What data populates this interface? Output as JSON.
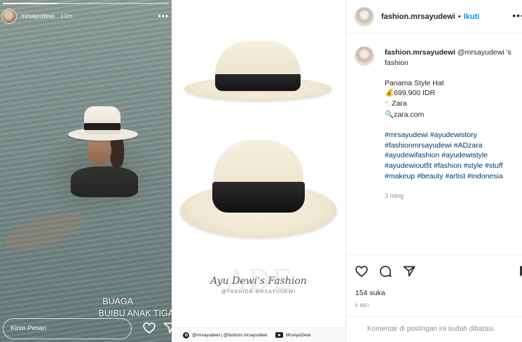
{
  "story": {
    "username": "mrsayudewi",
    "time": "13m",
    "progress": 0.33,
    "caption_line1": "BUAGA",
    "caption_line2": "BUIBU ANAK TIGA",
    "reply_placeholder": "Kirim Pesan"
  },
  "product_image": {
    "watermark": "ADE",
    "brand_name": "Ayu Dewi's Fashion",
    "brand_handle": "@FASHION.MRSAYUDEWI",
    "footer_instagram": "@mrsayudewi | @fashion.mrsayudewi",
    "footer_youtube": "MrsAyuDewi"
  },
  "post": {
    "header": {
      "username": "fashion.mrsayudewi",
      "separator": "•",
      "follow_label": "Ikuti"
    },
    "caption": {
      "username": "fashion.mrsayudewi",
      "mention": "@mrsayudewi 's",
      "line1_cont": "fashion",
      "product": "Panama Style Hat",
      "price_icon": "💰",
      "price": "699.900 IDR",
      "brand_icon": "🏷",
      "brand": "Zara",
      "site_icon": "🔍",
      "site": "zara.com",
      "hashtags": [
        "#mrsayudewi #ayudewistory",
        "#fashionmrsayudewi #ADzara",
        "#ayudewifashion #ayudewistyle",
        "#ayudewioutfit #fashion #style #stuff",
        "#makeup #beauty #artist #indonesia"
      ],
      "ago": "3 ming"
    },
    "likes": "154 suka",
    "date": "6 MEI",
    "comments_closed": "Komentar di postingan ini sudah dibatasi."
  },
  "icons": {
    "like": "heart-icon",
    "comment": "comment-icon",
    "share": "send-icon",
    "save": "bookmark-icon"
  }
}
